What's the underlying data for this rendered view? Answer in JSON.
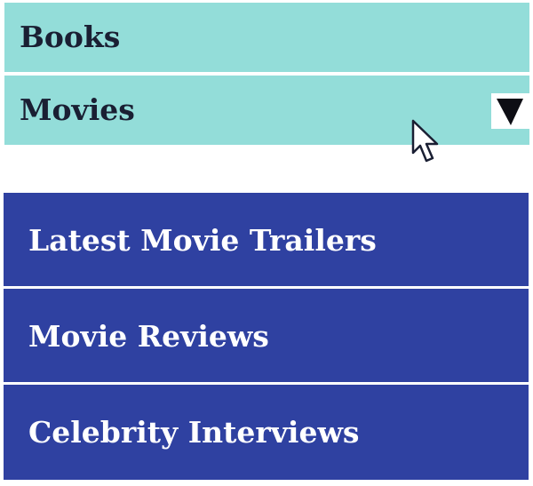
{
  "menu": {
    "items": [
      {
        "label": "Books"
      },
      {
        "label": "Movies",
        "expanded": true,
        "caret_icon": "triangle-down-icon"
      }
    ]
  },
  "submenu": {
    "items": [
      {
        "label": "Latest Movie Trailers"
      },
      {
        "label": "Movie Reviews"
      },
      {
        "label": "Celebrity Interviews"
      }
    ]
  },
  "colors": {
    "top_item_bg": "#93ddd9",
    "top_item_text": "#1a1f33",
    "submenu_bg": "#2f41a1",
    "submenu_text": "#ffffff"
  },
  "cursor": {
    "icon": "mouse-pointer-icon"
  }
}
